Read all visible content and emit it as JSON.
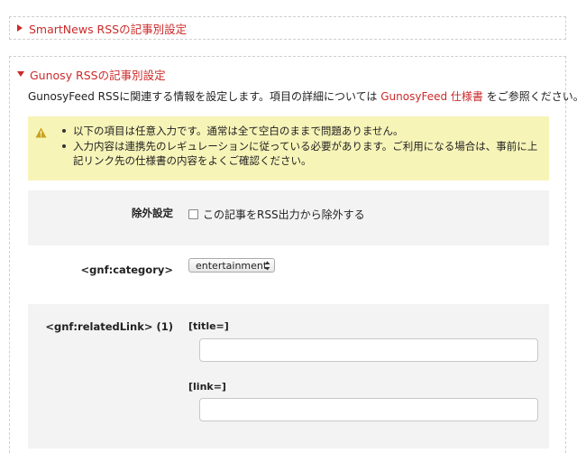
{
  "panels": {
    "smartnews": {
      "title": "SmartNews RSSの記事別設定"
    },
    "gunosy": {
      "title": "Gunosy RSSの記事別設定",
      "description_before": "GunosyFeed RSSに関連する情報を設定します。項目の詳細については ",
      "description_link": "GunosyFeed 仕様書",
      "description_after": " をご参照ください。",
      "notice": [
        "以下の項目は任意入力です。通常は全て空白のままで問題ありません。",
        "入力内容は連携先のレギュレーションに従っている必要があります。ご利用になる場合は、事前に上記リンク先の仕様書の内容をよくご確認ください。"
      ],
      "exclude": {
        "label": "除外設定",
        "checkbox_label": "この記事をRSS出力から除外する",
        "checked": false
      },
      "category": {
        "label": "<gnf:category>",
        "selected": "entertainment"
      },
      "related_link": {
        "label": "<gnf:relatedLink> (1)",
        "title_label": "[title=]",
        "title_value": "",
        "link_label": "[link=]",
        "link_value": ""
      }
    }
  },
  "colors": {
    "accent": "#cc2a2a",
    "notice_bg": "#f7f4b8",
    "row_bg": "#f3f3f3"
  },
  "icons": {
    "warning": "warning-icon",
    "collapsed": "triangle-right-icon",
    "expanded": "triangle-down-icon"
  }
}
